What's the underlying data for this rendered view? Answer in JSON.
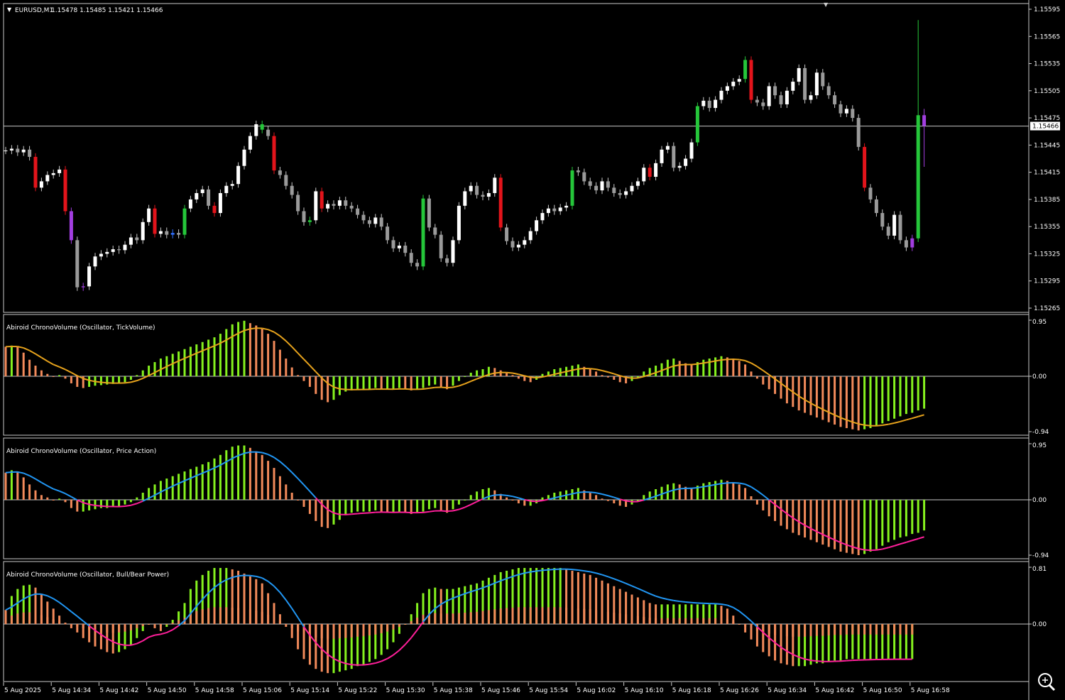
{
  "header": {
    "symbol": "EURUSD,M1",
    "ohlc": "1.15478 1.15485 1.15421 1.15466"
  },
  "colors": {
    "bull": "#ffffff",
    "bear": "#9a9a9a",
    "red": "#e3141b",
    "green": "#25c63a",
    "purple": "#a23ee0",
    "blue": "#2f6fff",
    "hist_up": "#86f21e",
    "hist_down": "#f28a5a",
    "line_tick": "#e6a21c",
    "line_pos": "#2196f3",
    "line_neg": "#ff1f9a",
    "grid": "#c8c8c8"
  },
  "chart_data": [
    {
      "type": "candlestick",
      "title": "EURUSD,M1",
      "ylim": [
        1.15255,
        1.156
      ],
      "yticks": [
        "1.15595",
        "1.15565",
        "1.15535",
        "1.15505",
        "1.15475",
        "1.15445",
        "1.15415",
        "1.15385",
        "1.15355",
        "1.15325",
        "1.15295",
        "1.15265"
      ],
      "current_price": "1.15466",
      "first_open": 1.15439,
      "closes": [
        1.15439,
        1.15441,
        1.15437,
        1.1544,
        1.15432,
        1.15398,
        1.15405,
        1.15412,
        1.15414,
        1.15418,
        1.15372,
        1.1534,
        1.15288,
        1.15289,
        1.15311,
        1.15322,
        1.15325,
        1.15327,
        1.1533,
        1.15329,
        1.15335,
        1.15343,
        1.1534,
        1.1536,
        1.15375,
        1.15347,
        1.1535,
        1.15346,
        1.15348,
        1.15346,
        1.15375,
        1.15385,
        1.15392,
        1.15396,
        1.15378,
        1.1537,
        1.15392,
        1.154,
        1.15402,
        1.15422,
        1.1544,
        1.15455,
        1.15468,
        1.15462,
        1.15455,
        1.15417,
        1.15412,
        1.154,
        1.1539,
        1.15372,
        1.1536,
        1.15362,
        1.15394,
        1.15375,
        1.1538,
        1.15378,
        1.15384,
        1.15378,
        1.15375,
        1.15368,
        1.15362,
        1.15358,
        1.15365,
        1.15355,
        1.1534,
        1.15331,
        1.15334,
        1.15326,
        1.15315,
        1.15311,
        1.15386,
        1.15354,
        1.15346,
        1.1532,
        1.15315,
        1.1534,
        1.15378,
        1.15394,
        1.154,
        1.1539,
        1.15388,
        1.15392,
        1.15409,
        1.15354,
        1.15339,
        1.15332,
        1.15335,
        1.1534,
        1.1535,
        1.15362,
        1.1537,
        1.15375,
        1.15372,
        1.15376,
        1.15378,
        1.15417,
        1.15415,
        1.15405,
        1.154,
        1.15395,
        1.15405,
        1.15398,
        1.15392,
        1.1539,
        1.15394,
        1.154,
        1.15405,
        1.1542,
        1.1541,
        1.15425,
        1.1544,
        1.15444,
        1.1542,
        1.15422,
        1.1543,
        1.15448,
        1.15488,
        1.15494,
        1.15486,
        1.15495,
        1.15505,
        1.1551,
        1.15515,
        1.15518,
        1.15539,
        1.15495,
        1.15492,
        1.15488,
        1.1551,
        1.155,
        1.1549,
        1.15505,
        1.15515,
        1.1553,
        1.15495,
        1.155,
        1.15525,
        1.1551,
        1.155,
        1.1549,
        1.1548,
        1.15485,
        1.15475,
        1.15443,
        1.15398,
        1.15385,
        1.1537,
        1.15355,
        1.15345,
        1.15368,
        1.1534,
        1.15332,
        1.15342,
        1.15478,
        1.15466
      ],
      "special_colors": {
        "5": "red",
        "10": "red",
        "11": "purple",
        "13": "purple",
        "25": "red",
        "28": "blue",
        "30": "green",
        "35": "red",
        "43": "green",
        "45": "red",
        "51": "green",
        "53": "red",
        "70": "green",
        "83": "red",
        "95": "green",
        "108": "red",
        "116": "green",
        "124": "green",
        "125": "red",
        "144": "red",
        "152": "purple",
        "153": "green",
        "154": "purple"
      },
      "wick_overrides": {
        "153": {
          "high": 1.15583
        },
        "154": {
          "high": 1.15485,
          "low": 1.15421
        }
      },
      "xticks": [
        "5 Aug 2025",
        "5 Aug 14:34",
        "5 Aug 14:42",
        "5 Aug 14:50",
        "5 Aug 14:58",
        "5 Aug 15:06",
        "5 Aug 15:14",
        "5 Aug 15:22",
        "5 Aug 15:30",
        "5 Aug 15:38",
        "5 Aug 15:46",
        "5 Aug 15:54",
        "5 Aug 16:02",
        "5 Aug 16:10",
        "5 Aug 16:18",
        "5 Aug 16:26",
        "5 Aug 16:34",
        "5 Aug 16:42",
        "5 Aug 16:50",
        "5 Aug 16:58"
      ]
    },
    {
      "type": "bar",
      "title": "Abiroid ChronoVolume (Oscillator, TickVolume)",
      "ylim": [
        -0.94,
        0.95
      ],
      "yticks": [
        "0.95",
        "0.00",
        "-0.94"
      ],
      "line_style": "single",
      "values": [
        50,
        52,
        50,
        40,
        28,
        18,
        10,
        4,
        0,
        2,
        -4,
        -12,
        -18,
        -20,
        -18,
        -16,
        -15,
        -14,
        -13,
        -12,
        -10,
        -6,
        2,
        10,
        18,
        24,
        30,
        34,
        38,
        42,
        46,
        50,
        54,
        58,
        62,
        66,
        72,
        80,
        88,
        92,
        94,
        90,
        86,
        80,
        72,
        60,
        45,
        30,
        15,
        2,
        -8,
        -18,
        -30,
        -40,
        -44,
        -40,
        -32,
        -26,
        -24,
        -22,
        -22,
        -22,
        -20,
        -22,
        -22,
        -22,
        -20,
        -22,
        -24,
        -22,
        -20,
        -16,
        -14,
        -18,
        -22,
        -16,
        -8,
        0,
        6,
        10,
        12,
        16,
        14,
        10,
        6,
        2,
        -4,
        -8,
        -10,
        -6,
        4,
        8,
        12,
        14,
        16,
        18,
        20,
        16,
        12,
        8,
        2,
        -2,
        -6,
        -10,
        -12,
        -8,
        -2,
        8,
        14,
        18,
        22,
        28,
        30,
        26,
        22,
        20,
        24,
        28,
        30,
        32,
        34,
        32,
        30,
        26,
        20,
        8,
        -4,
        -14,
        -22,
        -30,
        -38,
        -46,
        -52,
        -58,
        -62,
        -66,
        -70,
        -74,
        -78,
        -82,
        -86,
        -88,
        -90,
        -92,
        -90,
        -88,
        -84,
        -80,
        -76,
        -72,
        -68,
        -64,
        -62,
        -58,
        -55
      ]
    },
    {
      "type": "bar",
      "title": "Abiroid ChronoVolume (Oscillator, Price Action)",
      "ylim": [
        -0.94,
        0.95
      ],
      "yticks": [
        "0.95",
        "0.00",
        "-0.94"
      ],
      "line_style": "bicolor",
      "values": [
        46,
        50,
        48,
        38,
        26,
        16,
        8,
        4,
        0,
        2,
        -4,
        -14,
        -20,
        -20,
        -18,
        -16,
        -14,
        -14,
        -12,
        -12,
        -8,
        -4,
        4,
        12,
        20,
        26,
        32,
        36,
        40,
        44,
        48,
        52,
        56,
        60,
        64,
        70,
        76,
        84,
        90,
        92,
        92,
        88,
        82,
        76,
        66,
        54,
        40,
        26,
        12,
        0,
        -12,
        -24,
        -36,
        -46,
        -48,
        -42,
        -34,
        -26,
        -22,
        -20,
        -20,
        -20,
        -18,
        -20,
        -22,
        -22,
        -20,
        -22,
        -24,
        -22,
        -20,
        -16,
        -14,
        -18,
        -22,
        -16,
        -8,
        0,
        8,
        14,
        18,
        20,
        16,
        10,
        4,
        0,
        -6,
        -10,
        -10,
        -6,
        4,
        8,
        12,
        14,
        16,
        18,
        20,
        16,
        12,
        8,
        2,
        -2,
        -6,
        -10,
        -12,
        -8,
        -2,
        8,
        14,
        18,
        22,
        26,
        28,
        26,
        22,
        20,
        24,
        28,
        30,
        32,
        34,
        32,
        30,
        26,
        20,
        6,
        -8,
        -18,
        -28,
        -36,
        -44,
        -50,
        -56,
        -60,
        -64,
        -68,
        -72,
        -76,
        -80,
        -84,
        -88,
        -90,
        -92,
        -94,
        -92,
        -88,
        -84,
        -78,
        -72,
        -68,
        -64,
        -62,
        -58,
        -56,
        -52
      ]
    },
    {
      "type": "bar",
      "title": "Abiroid ChronoVolume (Oscillator, Bull/Bear Power)",
      "ylim": [
        -0.81,
        0.81
      ],
      "yticks": [
        "0.81",
        "0.00"
      ],
      "line_style": "bicolor",
      "values": [
        20,
        40,
        50,
        55,
        56,
        52,
        42,
        32,
        22,
        12,
        2,
        -6,
        -12,
        -20,
        -26,
        -32,
        -36,
        -40,
        -42,
        -40,
        -36,
        -30,
        -20,
        -10,
        0,
        -6,
        -10,
        -4,
        6,
        18,
        30,
        50,
        62,
        70,
        76,
        80,
        80,
        80,
        78,
        76,
        72,
        68,
        64,
        58,
        44,
        30,
        14,
        -4,
        -20,
        -36,
        -50,
        -58,
        -64,
        -68,
        -70,
        -70,
        -68,
        -66,
        -64,
        -60,
        -58,
        -54,
        -50,
        -44,
        -36,
        -26,
        -14,
        0,
        14,
        30,
        44,
        50,
        52,
        50,
        50,
        50,
        52,
        54,
        56,
        58,
        62,
        66,
        70,
        74,
        76,
        78,
        80,
        80,
        80,
        80,
        80,
        80,
        80,
        80,
        78,
        76,
        74,
        72,
        70,
        66,
        62,
        58,
        54,
        50,
        46,
        42,
        38,
        34,
        30,
        28,
        28,
        28,
        28,
        28,
        28,
        28,
        28,
        28,
        28,
        28,
        26,
        22,
        12,
        0,
        -12,
        -22,
        -32,
        -40,
        -46,
        -52,
        -56,
        -58,
        -60,
        -60,
        -60,
        -58,
        -56,
        -56,
        -54,
        -52,
        -52,
        -50,
        -50,
        -50,
        -50,
        -50,
        -50,
        -50,
        -50,
        -50,
        -50,
        -50,
        -50
      ]
    }
  ]
}
